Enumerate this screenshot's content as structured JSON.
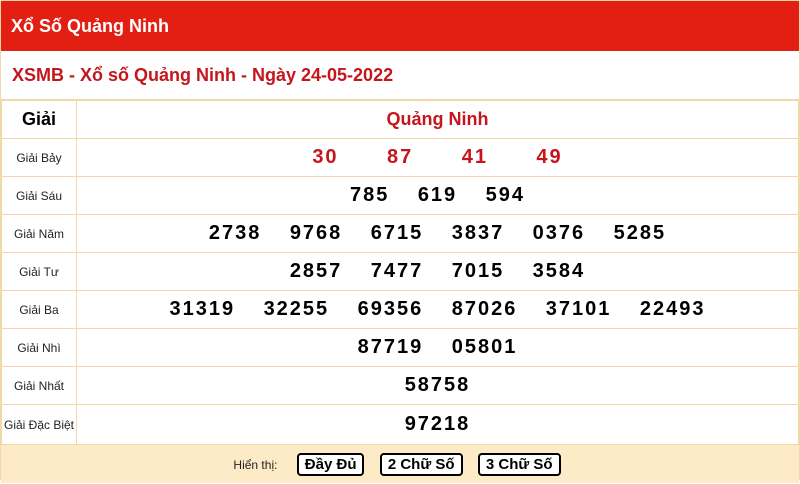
{
  "header": {
    "title": "Xổ Số Quảng Ninh"
  },
  "subtitle": "XSMB - Xổ số Quảng Ninh - Ngày 24-05-2022",
  "table": {
    "col_prize": "Giải",
    "col_province": "Quảng Ninh",
    "rows": [
      {
        "name": "Giải Bảy",
        "numbers": [
          "30",
          "87",
          "41",
          "49"
        ],
        "highlight": true
      },
      {
        "name": "Giải Sáu",
        "numbers": [
          "785",
          "619",
          "594"
        ]
      },
      {
        "name": "Giải Năm",
        "numbers": [
          "2738",
          "9768",
          "6715",
          "3837",
          "0376",
          "5285"
        ]
      },
      {
        "name": "Giải Tư",
        "numbers": [
          "2857",
          "7477",
          "7015",
          "3584"
        ]
      },
      {
        "name": "Giải Ba",
        "numbers": [
          "31319",
          "32255",
          "69356",
          "87026",
          "37101",
          "22493"
        ]
      },
      {
        "name": "Giải Nhì",
        "numbers": [
          "87719",
          "05801"
        ]
      },
      {
        "name": "Giải Nhất",
        "numbers": [
          "58758"
        ]
      },
      {
        "name": "Giải Đặc Biệt",
        "numbers": [
          "97218"
        ]
      }
    ]
  },
  "footer": {
    "label": "Hiển thị:",
    "buttons": [
      "Đầy Đủ",
      "2 Chữ Số",
      "3 Chữ Số"
    ]
  },
  "colors": {
    "header_bg": "#e21f12",
    "accent_red": "#c4161c",
    "footer_bg": "#fcebc6",
    "border": "#f0d8a8"
  }
}
